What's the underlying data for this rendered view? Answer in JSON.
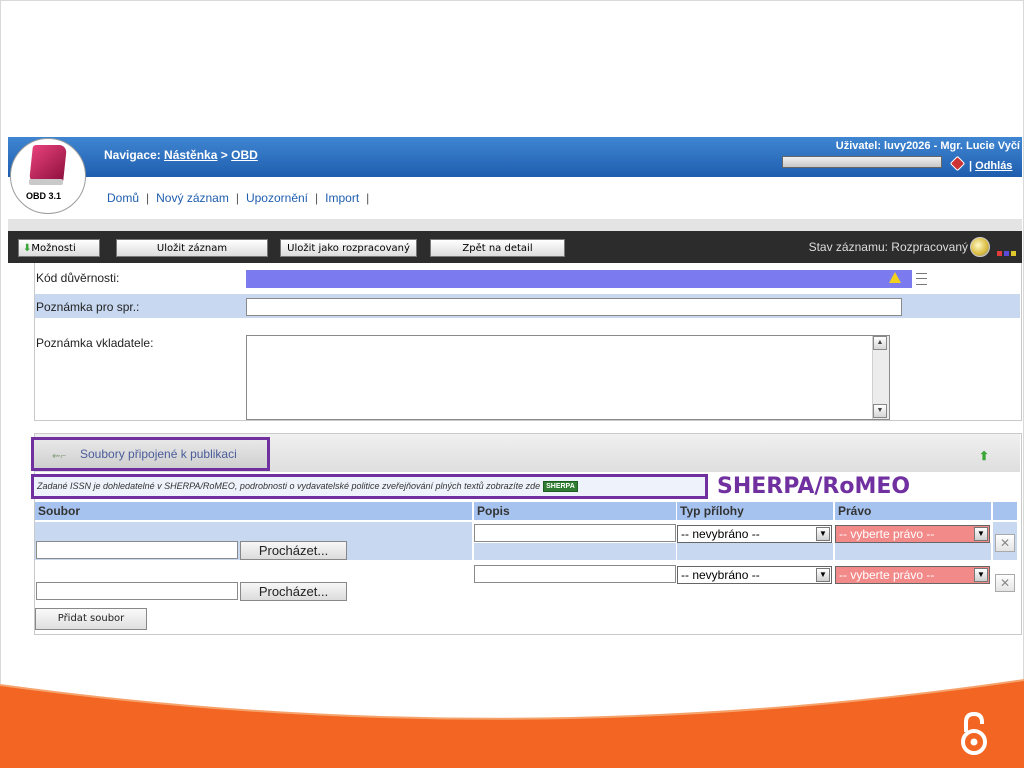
{
  "header": {
    "app_version": "OBD 3.1",
    "nav_label": "Navigace:",
    "nav_link1": "Nástěnka",
    "nav_sep": ">",
    "nav_link2": "OBD",
    "user": "Uživatel:  luvy2026 - Mgr. Lucie Vyčí",
    "logout": "Odhlás"
  },
  "menu": {
    "home": "Domů",
    "new_record": "Nový záznam",
    "notifications": "Upozornění",
    "import": "Import",
    "sep": "|"
  },
  "toolbar": {
    "options": "Možnosti",
    "save": "Uložit záznam",
    "save_draft": "Uložit jako rozpracovaný",
    "back": "Zpět na detail",
    "status": "Stav záznamu: Rozpracovaný"
  },
  "form": {
    "row1_label": "Kód důvěrnosti:",
    "row2_label": "Poznámka pro spr.:",
    "row3_label": "Poznámka vkladatele:"
  },
  "files": {
    "section_title": "Soubory připojené k publikaci",
    "sherpa_note": "Zadané ISSN je dohledatelné v SHERPA/RoMEO, podrobnosti o vydavatelské politice zveřejňování plných textů zobrazíte zde",
    "sherpa_logo": "SHERPA",
    "sherpa_callout": "SHERPA/RoMEO",
    "columns": [
      "Soubor",
      "Popis",
      "Typ přílohy",
      "Právo"
    ],
    "browse_label": "Procházet...",
    "type_default": "-- nevybráno --",
    "right_default": "-- vyberte právo --",
    "add_file": "Přidat soubor"
  },
  "colors": {
    "header_blue": "#1f5eae",
    "toolbar_dark": "#2c2c2c",
    "highlight_purple": "#7030a0",
    "footer_orange": "#f26522",
    "right_select_red": "#f28a8a"
  },
  "icons": [
    "book-logo-icon",
    "logout-icon",
    "warning-icon",
    "list-icon",
    "attach-icon",
    "up-arrow-icon",
    "status-globe-icon",
    "open-access-icon",
    "delete-icon"
  ]
}
